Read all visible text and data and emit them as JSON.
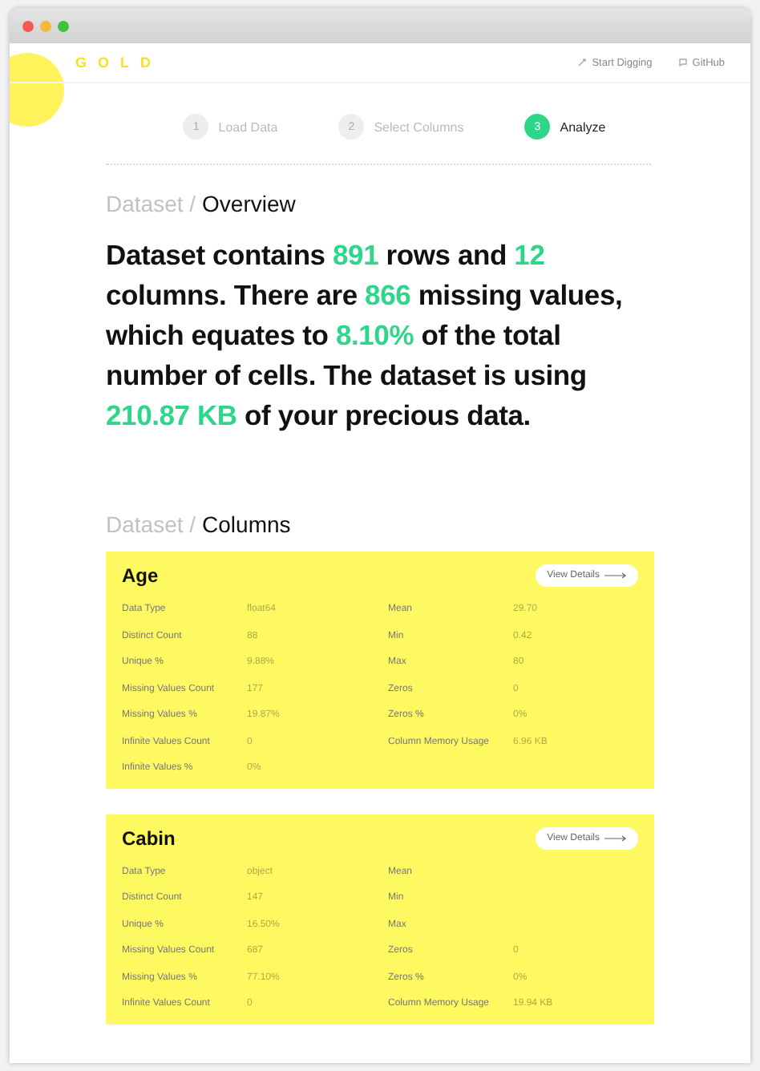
{
  "header": {
    "logo": "GOLD",
    "links": [
      {
        "label": "Start Digging"
      },
      {
        "label": "GitHub"
      }
    ]
  },
  "steps": [
    {
      "number": "1",
      "label": "Load Data",
      "selected": false
    },
    {
      "number": "2",
      "label": "Select Columns",
      "selected": false
    },
    {
      "number": "3",
      "label": "Analyze",
      "selected": true
    }
  ],
  "overview": {
    "crumb": "Dataset /",
    "title": "Overview",
    "summary": [
      {
        "text": "Dataset contains ",
        "highlight": false
      },
      {
        "text": "891",
        "highlight": true
      },
      {
        "text": " rows and ",
        "highlight": false
      },
      {
        "text": "12",
        "highlight": true
      },
      {
        "text": " columns. There are ",
        "highlight": false
      },
      {
        "text": "866",
        "highlight": true
      },
      {
        "text": " missing values, which equates to ",
        "highlight": false
      },
      {
        "text": "8.10%",
        "highlight": true
      },
      {
        "text": " of the total number of cells. The dataset is using ",
        "highlight": false
      },
      {
        "text": "210.87 KB",
        "highlight": true
      },
      {
        "text": " of your precious data.",
        "highlight": false
      }
    ]
  },
  "columns_section": {
    "crumb": "Dataset /",
    "title": "Columns",
    "columns": [
      {
        "name": "Age",
        "button": "View Details",
        "left": [
          {
            "label": "Data Type",
            "value": "float64"
          },
          {
            "label": "Distinct Count",
            "value": "88"
          },
          {
            "label": "Unique %",
            "value": "9.88%"
          },
          {
            "label": "Missing Values Count",
            "value": "177"
          },
          {
            "label": "Missing Values %",
            "value": "19.87%"
          },
          {
            "label": "Infinite Values Count",
            "value": "0"
          },
          {
            "label": "Infinite Values %",
            "value": "0%"
          }
        ],
        "right": [
          {
            "label": "Mean",
            "value": "29.70"
          },
          {
            "label": "Min",
            "value": "0.42"
          },
          {
            "label": "Max",
            "value": "80"
          },
          {
            "label": "Zeros",
            "value": "0"
          },
          {
            "label": "Zeros %",
            "value": "0%"
          },
          {
            "label": "Column Memory Usage",
            "value": "6.96 KB"
          }
        ]
      },
      {
        "name": "Cabin",
        "button": "View Details",
        "left": [
          {
            "label": "Data Type",
            "value": "object"
          },
          {
            "label": "Distinct Count",
            "value": "147"
          },
          {
            "label": "Unique %",
            "value": "16.50%"
          },
          {
            "label": "Missing Values Count",
            "value": "687"
          },
          {
            "label": "Missing Values %",
            "value": "77.10%"
          },
          {
            "label": "Infinite Values Count",
            "value": "0"
          }
        ],
        "right": [
          {
            "label": "Mean"
          },
          {
            "label": "Min"
          },
          {
            "label": "Max"
          },
          {
            "label": "Zeros",
            "value": "0"
          },
          {
            "label": "Zeros %",
            "value": "0%"
          },
          {
            "label": "Column Memory Usage",
            "value": "19.94 KB"
          }
        ]
      }
    ]
  }
}
